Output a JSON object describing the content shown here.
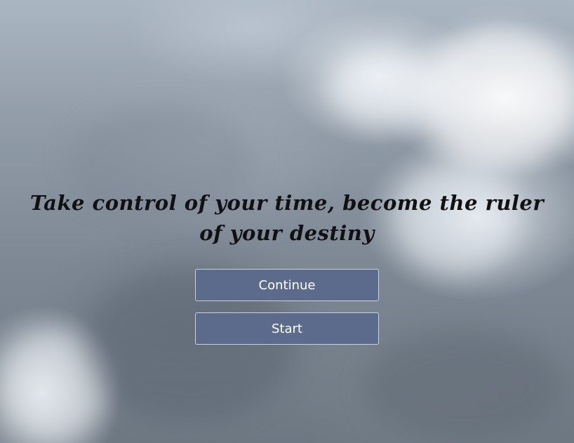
{
  "headline": "Take control of your time, become the ruler of your destiny",
  "buttons": {
    "continue_label": "Continue",
    "start_label": "Start"
  },
  "colors": {
    "button_bg": "#5c6a8b",
    "button_border": "#c9d0de",
    "button_text": "#ffffff",
    "headline_text": "#111111"
  }
}
